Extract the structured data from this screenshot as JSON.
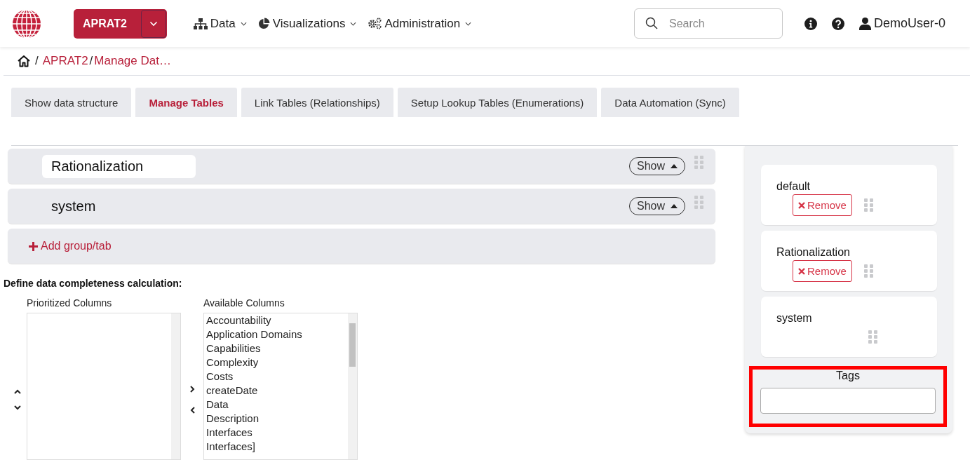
{
  "header": {
    "brand": "APRAT2",
    "menu": [
      {
        "label": "Data"
      },
      {
        "label": "Visualizations"
      },
      {
        "label": "Administration"
      }
    ],
    "search": {
      "placeholder": "Search"
    },
    "user": "DemoUser-0"
  },
  "breadcrumb": [
    {
      "separator": "/",
      "label": "APRAT2"
    },
    {
      "separator": "/",
      "label": "Manage Dat…"
    }
  ],
  "tabs": [
    {
      "label": "Show data structure",
      "selected": false
    },
    {
      "label": "Manage Tables",
      "selected": true
    },
    {
      "label": "Link Tables (Relationships)",
      "selected": false
    },
    {
      "label": "Setup Lookup Tables (Enumerations)",
      "selected": false
    },
    {
      "label": "Data Automation (Sync)",
      "selected": false
    }
  ],
  "groups": [
    {
      "name": "Rationalization",
      "toggle": "Show",
      "editing": true
    },
    {
      "name": "system",
      "toggle": "Show",
      "editing": false
    }
  ],
  "add_group": "Add group/tab",
  "completeness": {
    "title": "Define data completeness calculation:",
    "prioritized": {
      "label": "Prioritized Columns"
    },
    "available": {
      "label": "Available Columns",
      "items": [
        "Accountability",
        "Application Domains",
        "Capabilities",
        "Complexity",
        "Costs",
        "createDate",
        "Data",
        "Description",
        "Interfaces",
        "Interfaces]"
      ]
    }
  },
  "side_groups": [
    {
      "name": "default",
      "remove": "Remove"
    },
    {
      "name": "Rationalization",
      "remove": "Remove"
    },
    {
      "name": "system"
    }
  ],
  "tags": {
    "label": "Tags",
    "highlighted": true
  }
}
